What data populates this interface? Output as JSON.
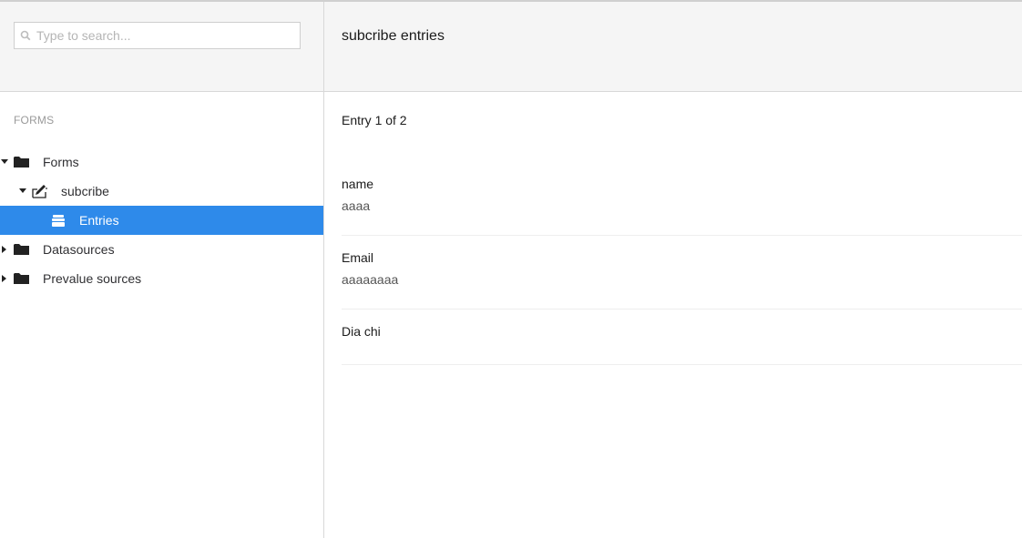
{
  "search": {
    "placeholder": "Type to search..."
  },
  "tree": {
    "section_title": "FORMS",
    "items": [
      {
        "label": "Forms",
        "icon": "folder-icon",
        "caret": "expanded"
      },
      {
        "label": "subcribe",
        "icon": "form-edit-icon",
        "caret": "expanded"
      },
      {
        "label": "Entries",
        "icon": "entries-icon",
        "caret": "none",
        "active": true
      },
      {
        "label": "Datasources",
        "icon": "folder-icon",
        "caret": "collapsed"
      },
      {
        "label": "Prevalue sources",
        "icon": "folder-icon",
        "caret": "collapsed"
      }
    ]
  },
  "content": {
    "title": "subcribe entries",
    "entry_counter": "Entry 1 of 2",
    "fields": [
      {
        "label": "name",
        "value": "aaaa"
      },
      {
        "label": "Email",
        "value": "aaaaaaaa"
      },
      {
        "label": "Dia chi",
        "value": ""
      }
    ]
  },
  "colors": {
    "active_item": "#2e8aea",
    "header_bg": "#f5f5f5",
    "border": "#d8d8d8"
  }
}
